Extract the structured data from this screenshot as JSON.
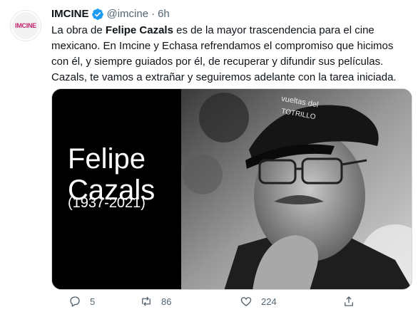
{
  "account": {
    "name": "IMCINE",
    "handle": "@imcine",
    "separator": "·",
    "time": "6h",
    "avatar_text": "IMCINE"
  },
  "tweet": {
    "text_before": "La obra de ",
    "text_bold": "Felipe Cazals",
    "text_after": " es de la mayor trascendencia para el cine mexicano. En Imcine y Echasa refrendamos el compromiso que hicimos con él, y siempre guiados por él, de recuperar y difundir sus películas. Cazals, te vamos a extrañar y seguiremos adelante con la tarea iniciada."
  },
  "media": {
    "overlay_line1": "Felipe",
    "overlay_line2": "Cazals",
    "overlay_years": "(1937-2021)",
    "cap_text": "vueltas del",
    "cap_text2": "TOTRILLO"
  },
  "actions": {
    "replies": "5",
    "retweets": "86",
    "likes": "224"
  },
  "colors": {
    "verified": "#1d9bf0",
    "secondary_text": "#536471",
    "brand_pink": "#c5226e"
  },
  "icons": [
    "reply-icon",
    "retweet-icon",
    "like-icon",
    "share-icon",
    "verified-icon"
  ]
}
